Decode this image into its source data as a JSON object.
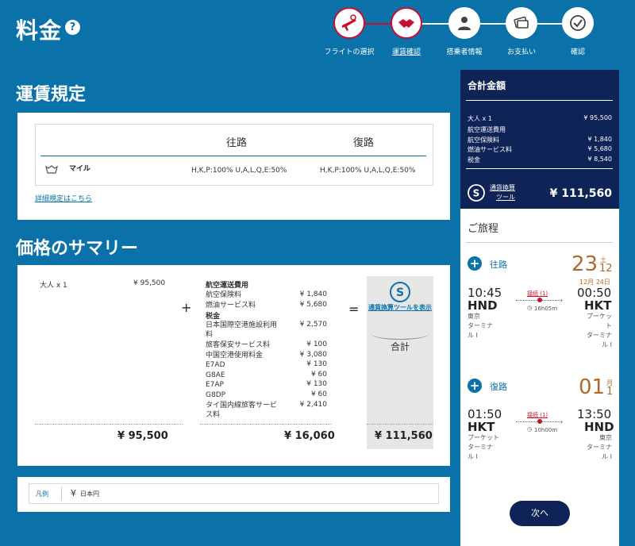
{
  "header": {
    "title": "料金",
    "help_icon": "question-circle-icon"
  },
  "steps": [
    {
      "label": "フライトの選択",
      "icon": "plane-check-icon",
      "state": "done"
    },
    {
      "label": "運賃確認",
      "icon": "handshake-icon",
      "state": "current"
    },
    {
      "label": "搭乗者情報",
      "icon": "person-icon",
      "state": "todo"
    },
    {
      "label": "お支払い",
      "icon": "payment-icon",
      "state": "todo"
    },
    {
      "label": "確認",
      "icon": "checkmark-icon",
      "state": "todo"
    }
  ],
  "fare_rules": {
    "title": "運賃規定",
    "outbound_header": "往路",
    "return_header": "復路",
    "row_label": "マイル",
    "row_icon": "miles-icon",
    "outbound_classes": "H,K,P:100% U,A,L,Q,E:50%",
    "return_classes": "H,K,P:100% U,A,L,Q,E:50%",
    "details_link": "詳細規定はこちら"
  },
  "price_summary": {
    "title": "価格のサマリー",
    "passenger_label": "大人 x 1",
    "passenger_fare": "¥ 95,500",
    "fees_heading": "航空運送費用",
    "fees": [
      {
        "label": "航空保険料",
        "value": "¥ 1,840"
      },
      {
        "label": "燃油サービス料",
        "value": "¥ 5,680"
      }
    ],
    "tax_heading": "税金",
    "taxes": [
      {
        "label": "日本国際空港施設利用料",
        "value": "¥ 2,570"
      },
      {
        "label": "旅客保安サービス料",
        "value": "¥ 100"
      },
      {
        "label": "中国空港使用料金",
        "value": "¥ 3,080"
      },
      {
        "label": "E7AD",
        "value": "¥ 130"
      },
      {
        "label": "G8AE",
        "value": "¥ 60"
      },
      {
        "label": "E7AP",
        "value": "¥ 130"
      },
      {
        "label": "G8DP",
        "value": "¥ 60"
      },
      {
        "label": "タイ国内線旅客サービス料",
        "value": "¥ 2,410"
      }
    ],
    "plus": "+",
    "equals": "=",
    "currency_tool": "通貨換算ツールを表示",
    "currency_icon": "currency-exchange-icon",
    "total_label": "合計",
    "fare_total": "¥ 95,500",
    "fees_total": "¥ 16,060",
    "grand_total": "¥ 111,560"
  },
  "legend": {
    "label": "凡例",
    "currency_symbol": "¥",
    "currency_name": "日本円"
  },
  "sidebar": {
    "title": "合計金額",
    "passenger": "大人 x 1",
    "passenger_fare": "¥ 95,500",
    "fees_heading": "航空運送費用",
    "rows": [
      {
        "label": "航空保険料",
        "value": "¥ 1,840"
      },
      {
        "label": "燃油サービス料",
        "value": "¥ 5,680"
      },
      {
        "label": "税金",
        "value": "¥ 8,540"
      }
    ],
    "currency_tool_1": "通貨換算",
    "currency_tool_2": "ツール",
    "total": "¥ 111,560",
    "itinerary_title": "ご旅程",
    "outbound": {
      "label": "往路",
      "day": "23",
      "weekday": "土",
      "month": "12",
      "date_note": "12月 24日",
      "dep_time": "10:45",
      "dep_code": "HND",
      "dep_city": "東京",
      "dep_term_1": "ターミナ",
      "dep_term_2": "ル I",
      "stops": "接続 (1)",
      "duration": "16h05m",
      "arr_time": "00:50",
      "arr_code": "HKT",
      "arr_city": "プーケッ",
      "arr_city_2": "ト",
      "arr_term_1": "ターミナ",
      "arr_term_2": "ル I"
    },
    "inbound": {
      "label": "復路",
      "day": "01",
      "weekday": "月",
      "month": "1",
      "dep_time": "01:50",
      "dep_code": "HKT",
      "dep_city": "プーケット",
      "dep_term_1": "ターミナ",
      "dep_term_2": "ル I",
      "stops": "接続 (1)",
      "duration": "10h00m",
      "arr_time": "13:50",
      "arr_code": "HND",
      "arr_city": "東京",
      "arr_term_1": "ターミナ",
      "arr_term_2": "ル I"
    },
    "next_button": "次へ"
  },
  "colors": {
    "background": "#0a72a8",
    "navy": "#0e2356",
    "accent_red": "#c8102e",
    "date_brown": "#b06a2a"
  }
}
